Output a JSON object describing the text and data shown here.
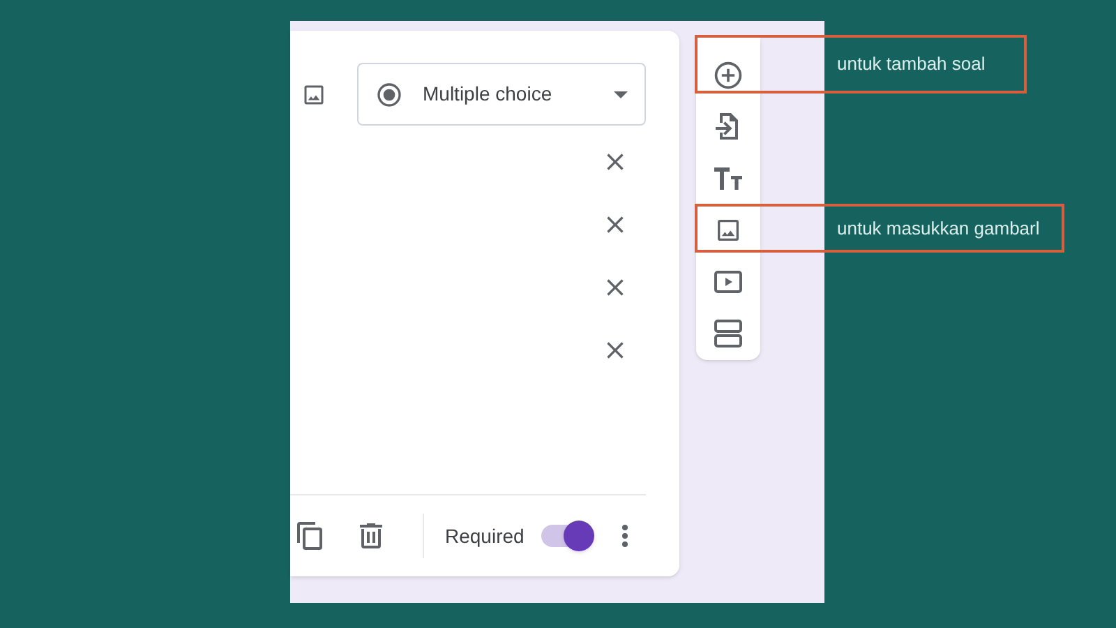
{
  "question": {
    "type_dropdown": "Multiple choice",
    "options": [
      {
        "removable": true
      },
      {
        "removable": true
      },
      {
        "removable": true
      },
      {
        "removable": true
      }
    ]
  },
  "footer": {
    "required_label": "Required",
    "required": true
  },
  "annotations": [
    {
      "text": "untuk tambah soal"
    },
    {
      "text": "untuk masukkan gambarl"
    }
  ]
}
